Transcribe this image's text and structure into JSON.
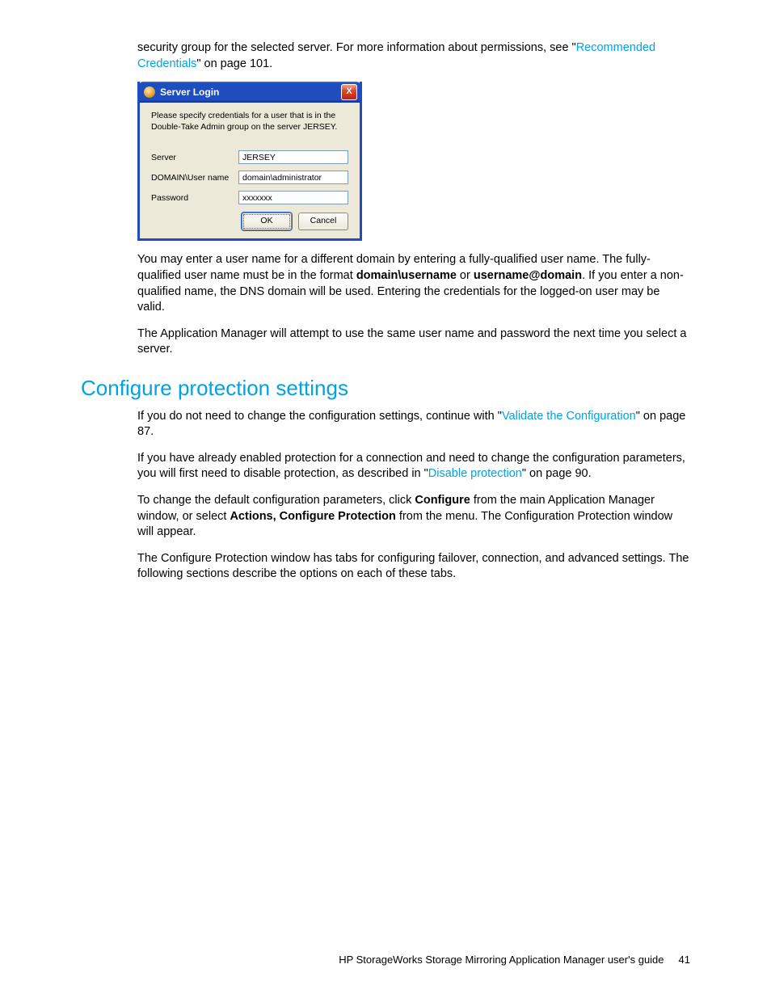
{
  "intro": {
    "p1_a": "security group for the selected server. For more information about permissions, see \"",
    "p1_link": "Recommended Credentials",
    "p1_b": "\" on page 101."
  },
  "dialog": {
    "title": "Server Login",
    "close_glyph": "X",
    "message": "Please specify credentials for a user that is in the Double-Take Admin group on the server JERSEY.",
    "labels": {
      "server": "Server",
      "user": "DOMAIN\\User name",
      "password": "Password"
    },
    "values": {
      "server": "JERSEY",
      "user": "domain\\administrator",
      "password": "xxxxxxx"
    },
    "buttons": {
      "ok": "OK",
      "cancel": "Cancel"
    }
  },
  "after": {
    "p2_a": "You may enter a user name for a different domain by entering a fully-qualified user name. The fully-qualified user name must be in the format ",
    "p2_b1": "domain\\username",
    "p2_c": " or ",
    "p2_b2": "username@domain",
    "p2_d": ". If you enter a non-qualified name, the DNS domain will be used. Entering the credentials for the logged-on user may be valid.",
    "p3": "The Application Manager will attempt to use the same user name and password the next time you select a server."
  },
  "section": {
    "heading": "Configure protection settings",
    "p4_a": "If you do not need to change the configuration settings, continue with \"",
    "p4_link": "Validate the Configuration",
    "p4_b": "\" on page 87.",
    "p5_a": "If you have already enabled protection for a connection and need to change the configuration parameters, you will first need to disable protection, as described in \"",
    "p5_link": "Disable protection",
    "p5_b": "\" on page 90.",
    "p6_a": "To change the default configuration parameters, click ",
    "p6_b1": "Configure",
    "p6_b": " from the main Application Manager window, or select ",
    "p6_b2": "Actions, Configure Protection",
    "p6_c": " from the menu. The Configuration Protection window will appear.",
    "p7": "The Configure Protection window has tabs for configuring failover, connection, and advanced settings. The following sections describe the options on each of these tabs."
  },
  "footer": {
    "title": "HP StorageWorks Storage Mirroring Application Manager user's guide",
    "page": "41"
  }
}
